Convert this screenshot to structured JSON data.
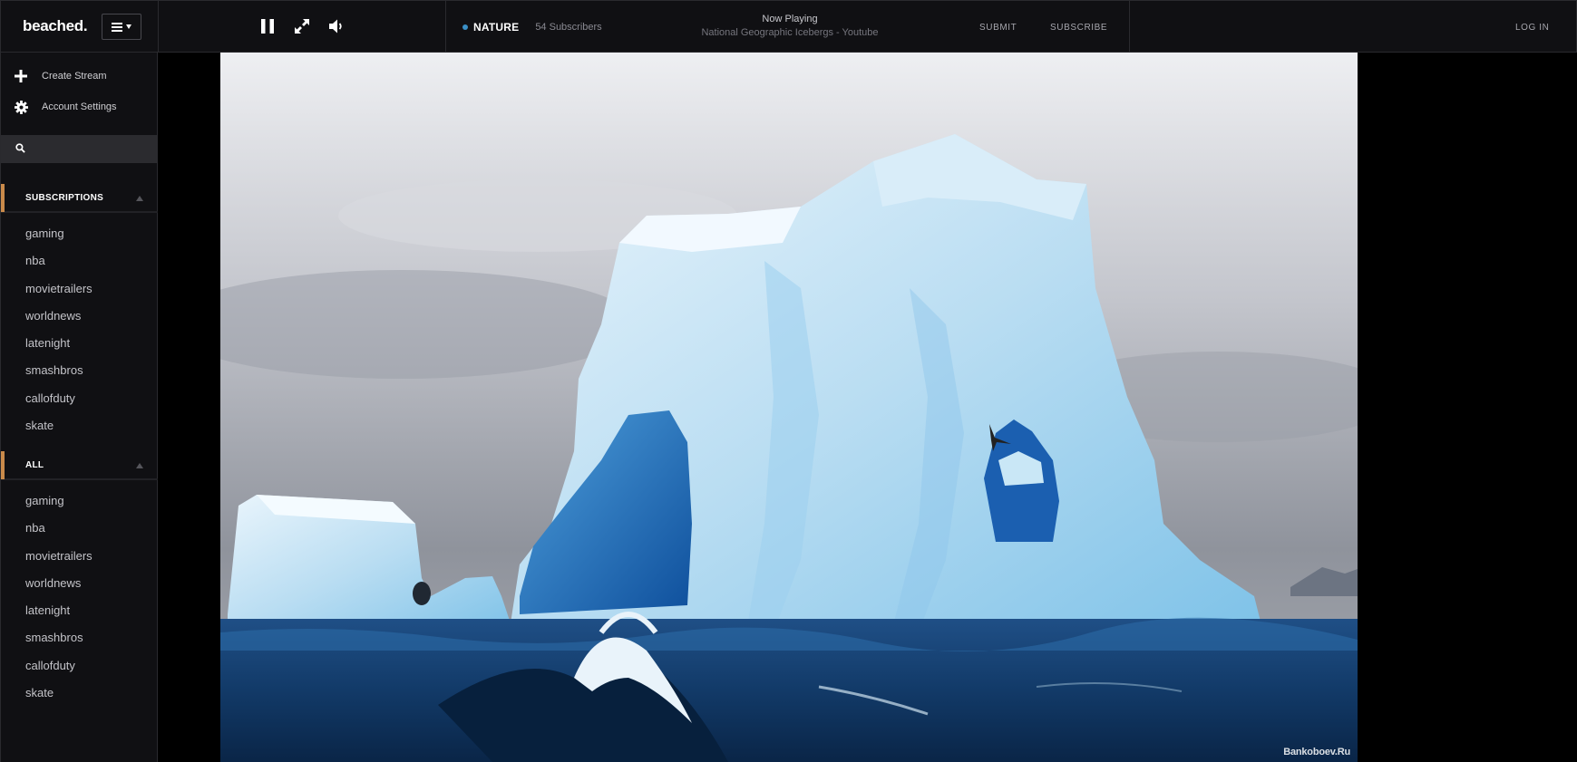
{
  "app": {
    "logo": "beached."
  },
  "header": {
    "menu_button": "menu",
    "controls": [
      "pause",
      "fullscreen",
      "volume"
    ],
    "channel": {
      "name": "NATURE",
      "subscribers": "54 Subscribers",
      "live_color": "#3a8fc6"
    },
    "now_playing": {
      "label": "Now Playing",
      "title": "National Geographic Icebergs - Youtube"
    },
    "links": {
      "submit": "SUBMIT",
      "subscribe": "SUBSCRIBE",
      "login": "LOG IN"
    }
  },
  "sidebar": {
    "actions": {
      "create_stream": "Create Stream",
      "account_settings": "Account Settings"
    },
    "search": {
      "placeholder": ""
    },
    "subscriptions": {
      "label": "SUBSCRIPTIONS",
      "items": [
        "gaming",
        "nba",
        "movietrailers",
        "worldnews",
        "latenight",
        "smashbros",
        "callofduty",
        "skate"
      ]
    },
    "all": {
      "label": "ALL",
      "items": [
        "gaming",
        "nba",
        "movietrailers",
        "worldnews",
        "latenight",
        "smashbros",
        "callofduty",
        "skate"
      ]
    },
    "accent_color": "#c98a4a"
  },
  "video": {
    "watermark": "Bankoboev.Ru"
  }
}
